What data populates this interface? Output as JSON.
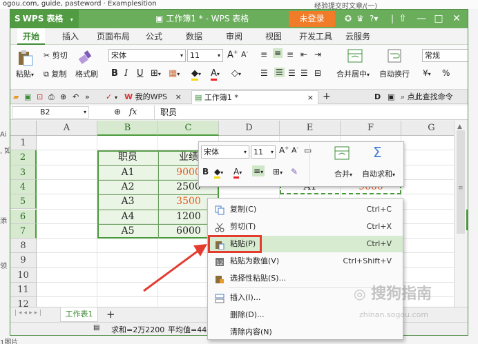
{
  "window": {
    "app_name": "WPS 表格",
    "title": "工作簿1 * - WPS 表格",
    "login_label": "未登录",
    "help_label": "?",
    "controls": {
      "minimize": "—",
      "restore": "□",
      "close": "✕"
    }
  },
  "background": {
    "url_fragment": "ogou.com, guide, pasteword · Examplesition",
    "right_fragment": "经验提交时文章/(一)",
    "left_fragments": [
      "Ai",
      ", 如",
      "添",
      "领",
      "1图片"
    ]
  },
  "menu": {
    "tabs": [
      "开始",
      "插入",
      "页面布局",
      "公式",
      "数据",
      "审阅",
      "视图",
      "开发工具",
      "云服务"
    ],
    "active": "开始"
  },
  "ribbon": {
    "paste_label": "粘贴",
    "cut_label": "剪切",
    "copy_label": "复制",
    "format_painter_label": "格式刷",
    "font_name": "宋体",
    "font_size": "11",
    "bold": "B",
    "italic": "I",
    "underline": "U",
    "merge_label": "合并居中",
    "wrap_label": "自动换行",
    "number_format": "常规",
    "percent": "%"
  },
  "tabs_bar": {
    "mywps_label": "我的WPS",
    "workbook_tab": "工作簿1 *",
    "search_label": "点此查找命令",
    "letter_d": "D"
  },
  "formula_bar": {
    "name_box": "B2",
    "fx_label": "fx",
    "content": "职员"
  },
  "sheet": {
    "columns": [
      "A",
      "B",
      "C",
      "D",
      "E",
      "F",
      "G"
    ],
    "rows": [
      "1",
      "2",
      "3",
      "4",
      "5",
      "6",
      "7",
      "8",
      "9",
      "10",
      "11",
      "12"
    ],
    "header_row": [
      "职员",
      "业绩"
    ],
    "data": [
      {
        "name": "A1",
        "score": "9000"
      },
      {
        "name": "A2",
        "score": "2500"
      },
      {
        "name": "A3",
        "score": "3500"
      },
      {
        "name": "A4",
        "score": "1200"
      },
      {
        "name": "A5",
        "score": "6000"
      }
    ],
    "pasted_name": "A1",
    "pasted_score": "9000",
    "red_score_color": "#e05a1e"
  },
  "mini_toolbar": {
    "font_name": "宋体",
    "font_size": "11",
    "bold": "B",
    "merge_label": "合并",
    "autosum_label": "自动求和"
  },
  "context_menu": {
    "items": [
      {
        "label": "复制(C)",
        "shortcut": "Ctrl+C",
        "icon": "copy-icon"
      },
      {
        "label": "剪切(T)",
        "shortcut": "Ctrl+X",
        "icon": "scissors-icon"
      },
      {
        "label": "粘贴(P)",
        "shortcut": "Ctrl+V",
        "icon": "paste-icon"
      },
      {
        "label": "粘贴为数值(V)",
        "shortcut": "Ctrl+Shift+V",
        "icon": "paste-values-icon"
      },
      {
        "label": "选择性粘贴(S)...",
        "shortcut": "",
        "icon": "paste-special-icon"
      },
      {
        "label": "插入(I)...",
        "shortcut": "",
        "icon": "insert-icon"
      },
      {
        "label": "删除(D)...",
        "shortcut": "",
        "icon": ""
      },
      {
        "label": "清除内容(N)",
        "shortcut": "",
        "icon": ""
      }
    ],
    "highlighted": "粘贴(P)",
    "highlight_color": "#e33b2e"
  },
  "sheet_tabs": {
    "active": "工作表1",
    "add_label": "+"
  },
  "status_bar": {
    "sum": "求和=2万2200",
    "avg": "平均值=44."
  },
  "watermark": {
    "text": "搜狗指南",
    "domain": "zhinan.sogou.com"
  },
  "accent_colors": {
    "wps_green": "#6aae5c",
    "login_orange": "#f07c2a",
    "arrow_red": "#e33b2e"
  }
}
